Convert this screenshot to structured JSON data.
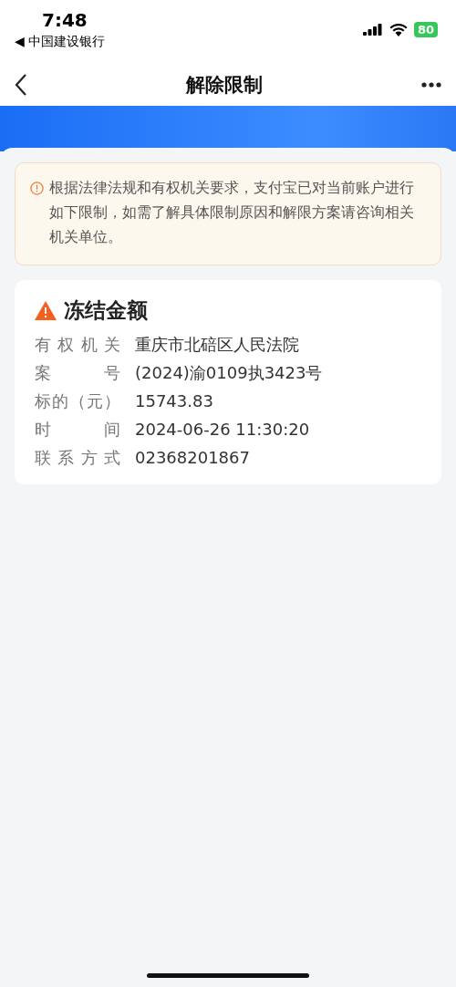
{
  "status_bar": {
    "time": "7:48",
    "carrier": "◀ 中国建设银行",
    "battery": "80"
  },
  "nav_bar": {
    "title": "解除限制"
  },
  "notice": {
    "text": "根据法律法规和有权机关要求，支付宝已对当前账户进行如下限制，如需了解具体限制原因和解限方案请咨询相关机关单位。"
  },
  "restriction": {
    "title": "冻结金额",
    "fields": [
      {
        "label": "有权机关",
        "value": "重庆市北碚区人民法院"
      },
      {
        "label": "案号",
        "value": "(2024)渝0109执3423号"
      },
      {
        "label": "标的（元）",
        "value": "15743.83"
      },
      {
        "label": "时间",
        "value": "2024-06-26 11:30:20"
      },
      {
        "label": "联系方式",
        "value": "02368201867"
      }
    ]
  }
}
